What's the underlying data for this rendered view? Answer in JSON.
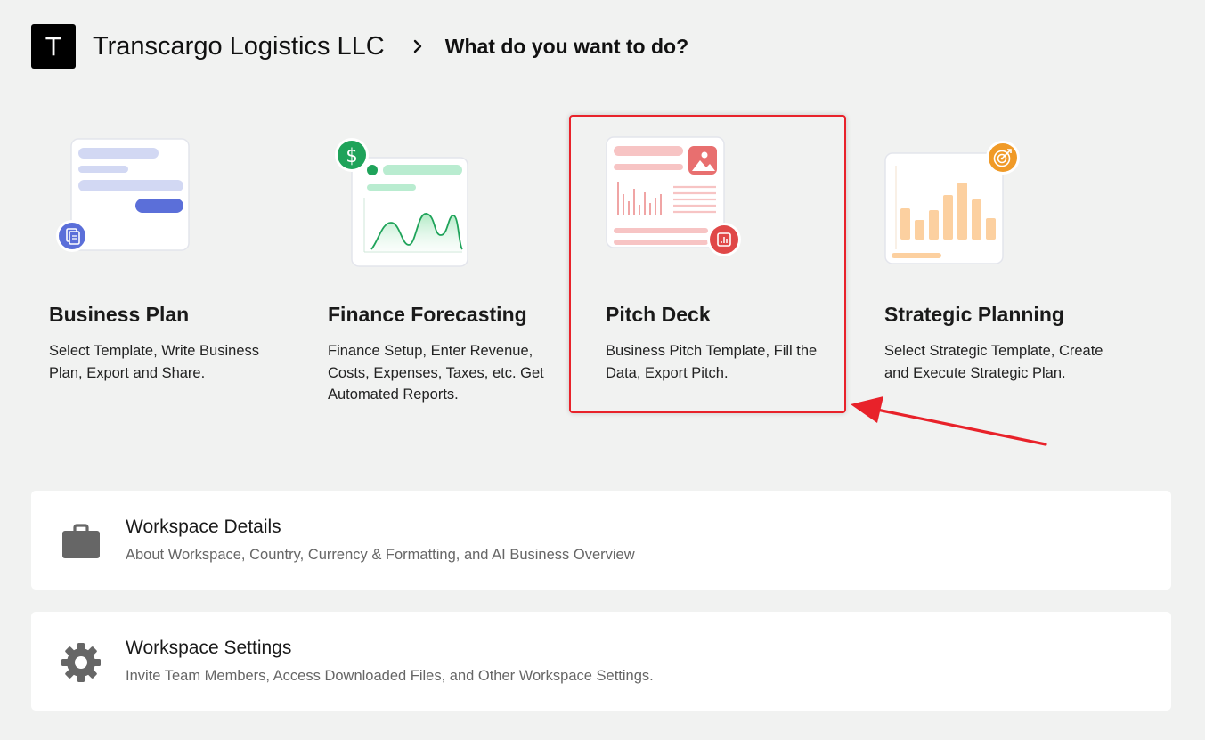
{
  "header": {
    "logo_letter": "T",
    "company": "Transcargo Logistics LLC",
    "title": "What do you want to do?"
  },
  "cards": [
    {
      "title": "Business Plan",
      "description": "Select Template, Write Business Plan, Export and Share.",
      "icon": "document-icon",
      "accent": "#5b6fd9"
    },
    {
      "title": "Finance Forecasting",
      "description": "Finance Setup, Enter Revenue, Costs, Expenses, Taxes, etc. Get Automated Reports.",
      "icon": "dollar-icon",
      "accent": "#1fa35a"
    },
    {
      "title": "Pitch Deck",
      "description": "Business Pitch Template, Fill the Data, Export Pitch.",
      "icon": "presentation-chart-icon",
      "accent": "#e04848"
    },
    {
      "title": "Strategic Planning",
      "description": "Select Strategic Template, Create and Execute Strategic Plan.",
      "icon": "target-icon",
      "accent": "#f09a27"
    }
  ],
  "rows": [
    {
      "title": "Workspace Details",
      "description": "About Workspace, Country, Currency & Formatting, and AI Business Overview",
      "icon": "briefcase-icon"
    },
    {
      "title": "Workspace Settings",
      "description": "Invite Team Members, Access Downloaded Files, and Other Workspace Settings.",
      "icon": "gear-icon"
    }
  ],
  "annotation": {
    "highlight_color": "#e8222a"
  }
}
